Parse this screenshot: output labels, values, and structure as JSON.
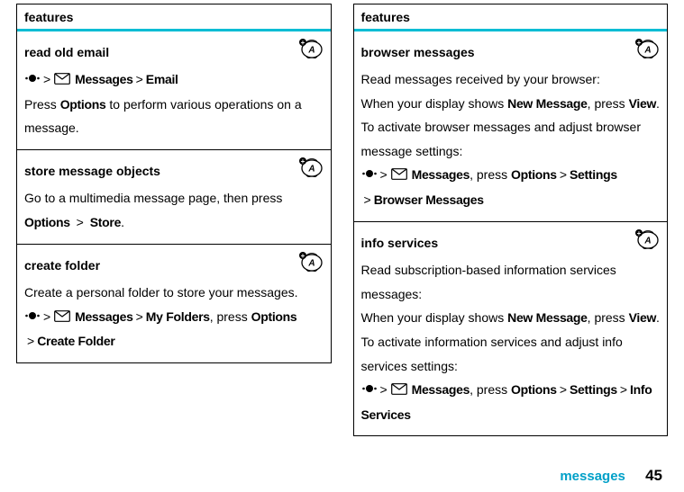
{
  "header": "features",
  "left": [
    {
      "title": "read old email",
      "lines": [
        {
          "type": "path",
          "parts": [
            "center",
            ">",
            "envelope",
            " ",
            "Messages",
            ">",
            "Email"
          ],
          "styles": [
            "icon",
            "gt",
            "icon",
            "",
            "cond",
            "gt",
            "cond"
          ]
        },
        {
          "type": "text",
          "runs": [
            [
              "Press ",
              ""
            ],
            [
              "Options",
              "cond"
            ],
            [
              " to perform various operations on a message.",
              ""
            ]
          ]
        }
      ],
      "badge": true
    },
    {
      "title": "store message objects",
      "lines": [
        {
          "type": "text",
          "runs": [
            [
              "Go to a multimedia message page, then press ",
              ""
            ],
            [
              "Options",
              "cond"
            ],
            [
              " > ",
              "gt"
            ],
            [
              "Store",
              "cond"
            ],
            [
              ".",
              ""
            ]
          ]
        }
      ],
      "badge": true
    },
    {
      "title": "create folder",
      "lines": [
        {
          "type": "text",
          "runs": [
            [
              "Create a personal folder to store your messages.",
              ""
            ]
          ]
        },
        {
          "type": "path",
          "parts": [
            "center",
            ">",
            "envelope",
            " ",
            "Messages",
            ">",
            "My Folders",
            ", press ",
            "Options"
          ],
          "styles": [
            "icon",
            "gt",
            "icon",
            "",
            "cond",
            "gt",
            "cond",
            "",
            "cond"
          ]
        },
        {
          "type": "path",
          "parts": [
            ">",
            "Create Folder"
          ],
          "styles": [
            "gt",
            "cond"
          ]
        }
      ],
      "badge": true
    }
  ],
  "right": [
    {
      "title": "browser messages",
      "lines": [
        {
          "type": "text",
          "runs": [
            [
              "Read messages received by your browser:",
              ""
            ]
          ]
        },
        {
          "type": "text",
          "runs": [
            [
              "When your display shows ",
              ""
            ],
            [
              "New Message",
              "cond"
            ],
            [
              ", press ",
              ""
            ],
            [
              "View",
              "cond"
            ],
            [
              ".",
              ""
            ]
          ]
        },
        {
          "type": "text",
          "runs": [
            [
              "To activate browser messages and adjust browser message settings:",
              ""
            ]
          ]
        },
        {
          "type": "path",
          "parts": [
            "center",
            ">",
            "envelope",
            " ",
            "Messages",
            ", press ",
            "Options",
            ">",
            "Settings"
          ],
          "styles": [
            "icon",
            "gt",
            "icon",
            "",
            "cond",
            "",
            "cond",
            "gt",
            "cond"
          ]
        },
        {
          "type": "path",
          "parts": [
            ">",
            "Browser Messages"
          ],
          "styles": [
            "gt",
            "cond"
          ]
        }
      ],
      "badge": true
    },
    {
      "title": "info services",
      "lines": [
        {
          "type": "text",
          "runs": [
            [
              "Read subscription-based information services messages:",
              ""
            ]
          ]
        },
        {
          "type": "text",
          "runs": [
            [
              "When your display shows ",
              ""
            ],
            [
              "New Message",
              "cond"
            ],
            [
              ", press ",
              ""
            ],
            [
              "View",
              "cond"
            ],
            [
              ".",
              ""
            ]
          ]
        },
        {
          "type": "text",
          "runs": [
            [
              "To activate information services and adjust info services settings:",
              ""
            ]
          ]
        },
        {
          "type": "path",
          "parts": [
            "center",
            ">",
            "envelope",
            " ",
            "Messages",
            ", press ",
            "Options",
            ">",
            "Settings",
            ">",
            "Info Services"
          ],
          "styles": [
            "icon",
            "gt",
            "icon",
            "",
            "cond",
            "",
            "cond",
            "gt",
            "cond",
            "gt",
            "cond"
          ]
        }
      ],
      "badge": true
    }
  ],
  "footer": {
    "label": "messages",
    "page": "45"
  }
}
